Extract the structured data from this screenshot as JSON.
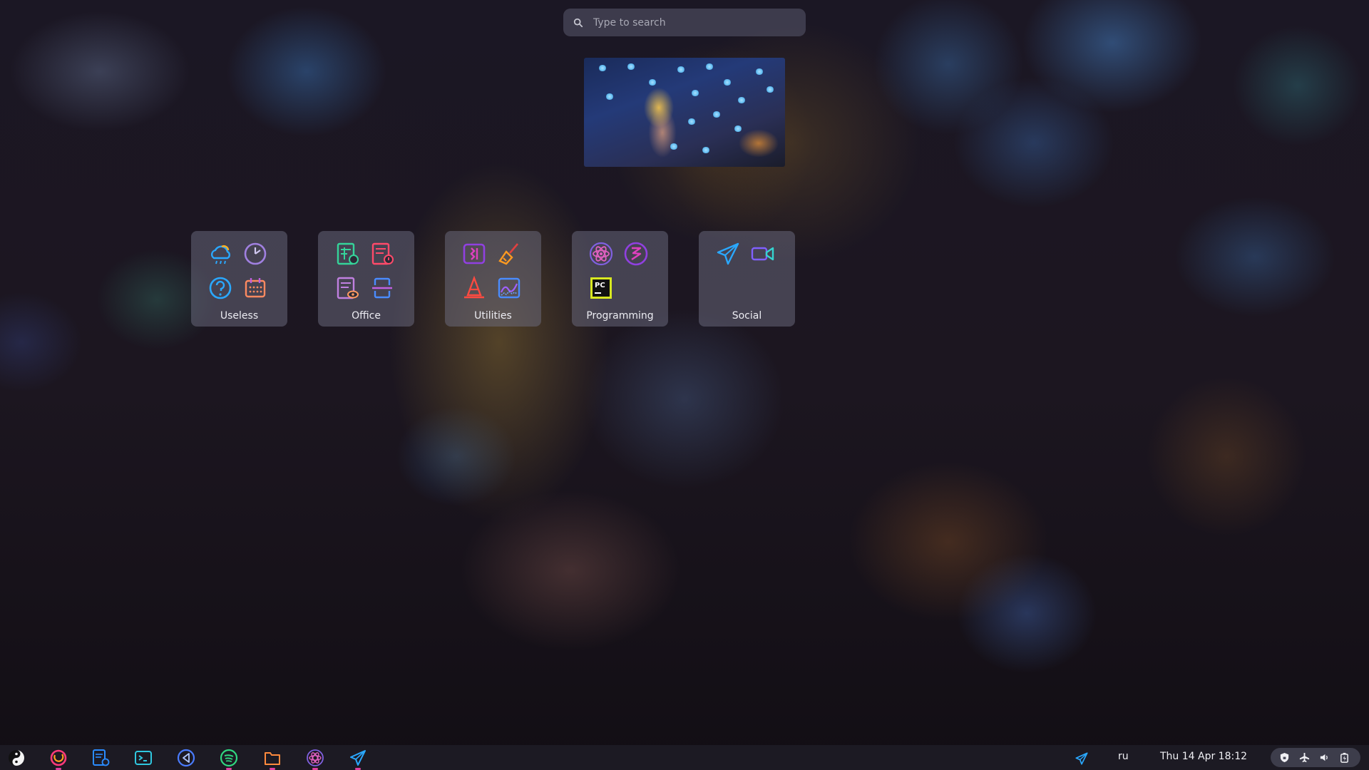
{
  "search": {
    "placeholder": "Type to search"
  },
  "folders": [
    {
      "label": "Useless",
      "icons": [
        "weather-icon",
        "clock-icon",
        "help-icon",
        "calendar-icon"
      ]
    },
    {
      "label": "Office",
      "icons": [
        "spreadsheet-icon",
        "presentation-icon",
        "document-viewer-icon",
        "scanner-icon"
      ]
    },
    {
      "label": "Utilities",
      "icons": [
        "split-pane-icon",
        "broom-icon",
        "vlc-icon",
        "system-monitor-icon"
      ]
    },
    {
      "label": "Programming",
      "icons": [
        "atom-icon",
        "emacs-icon",
        "pycharm-icon"
      ]
    },
    {
      "label": "Social",
      "icons": [
        "telegram-icon",
        "video-call-icon"
      ]
    }
  ],
  "taskbar": {
    "apps": [
      "activities-icon",
      "firefox-icon",
      "text-editor-icon",
      "terminal-icon",
      "vscode-icon",
      "spotify-icon",
      "files-icon",
      "atom-icon",
      "telegram-icon"
    ],
    "tray_telegram": "telegram-tray-icon",
    "keyboard_layout": "ru",
    "datetime": "Thu 14 Apr  18:12",
    "system_icons": [
      "shield-icon",
      "airplane-icon",
      "volume-icon",
      "battery-icon"
    ]
  },
  "colors": {
    "accent_pink": "#e040a0",
    "accent_blue": "#2aa8ff",
    "accent_green": "#35d49a",
    "accent_orange": "#ff8a3d",
    "accent_purple": "#a060ff"
  }
}
